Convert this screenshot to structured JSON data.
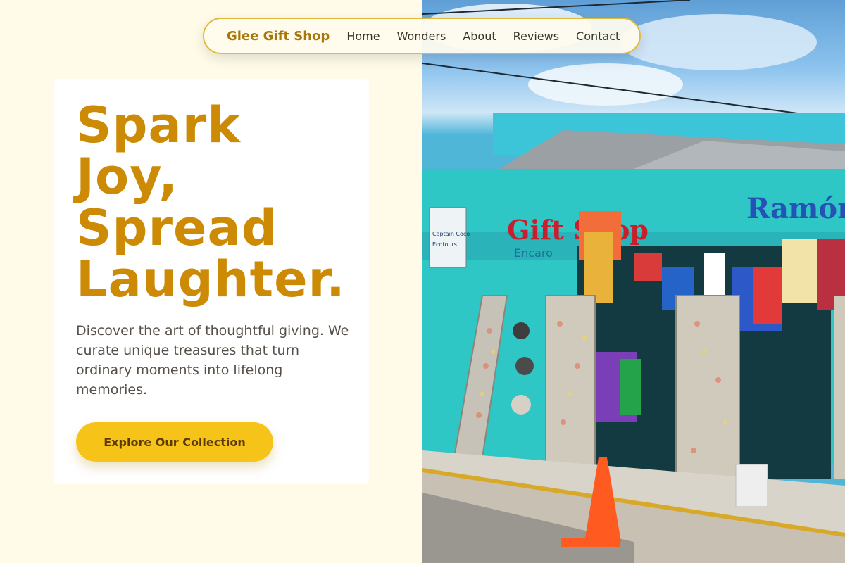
{
  "nav": {
    "brand": "Glee Gift Shop",
    "links": [
      "Home",
      "Wonders",
      "About",
      "Reviews",
      "Contact"
    ]
  },
  "hero": {
    "headline": [
      "Spark",
      "Joy,",
      "Spread",
      "Laughter."
    ],
    "description": "Discover the art of thoughtful giving. We curate unique treasures that turn ordinary moments into lifelong memories.",
    "cta_label": "Explore Our Collection"
  },
  "photo": {
    "sign_left": "Gift Shop",
    "sign_right": "Ramón",
    "small_sign_1": "Captain Coco",
    "small_sign_2": "Ecotours",
    "sign_encaro": "Encaro"
  },
  "colors": {
    "accent": "#cc8a05",
    "button": "#f6c418",
    "page_bg": "#fffbe8",
    "shop_teal": "#2fc6c6"
  }
}
